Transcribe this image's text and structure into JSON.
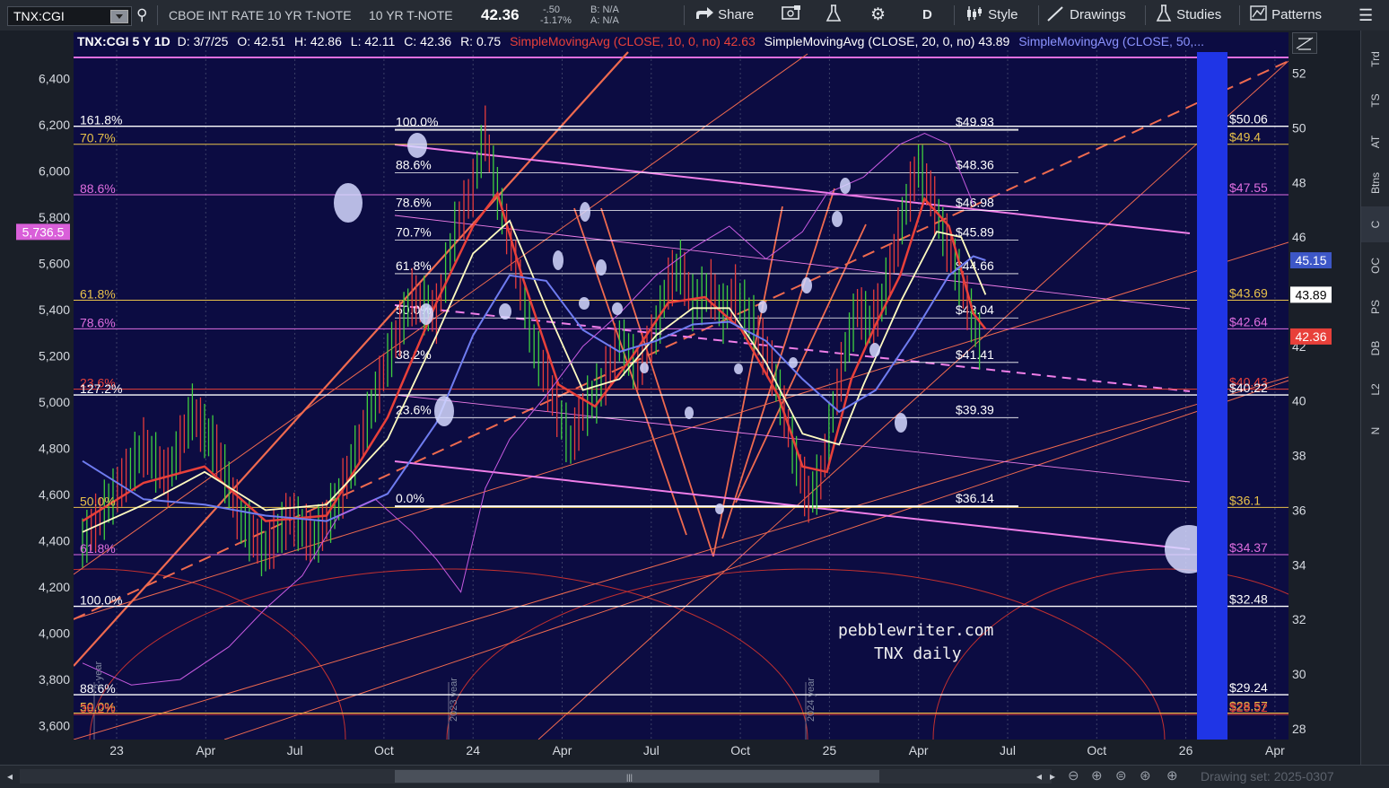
{
  "toolbar": {
    "symbol": "TNX:CGI",
    "exchange": "CBOE INT RATE 10 YR T-NOTE",
    "description": "10 YR T-NOTE",
    "last": "42.36",
    "change": "-.50",
    "change_pct": "-1.17%",
    "bid": "B: N/A",
    "ask": "A: N/A",
    "share": "Share",
    "period": "D",
    "style": "Style",
    "drawings": "Drawings",
    "studies": "Studies",
    "patterns": "Patterns"
  },
  "header": {
    "symbol": "TNX:CGI 5 Y 1D",
    "date": "D: 3/7/25",
    "open": "O: 42.51",
    "high": "H: 42.86",
    "low": "L: 42.11",
    "close": "C: 42.36",
    "range": "R: 0.75",
    "sma10": "SimpleMovingAvg (CLOSE, 10, 0, no)",
    "sma10_val": "42.63",
    "sma20": "SimpleMovingAvg (CLOSE, 20, 0, no)",
    "sma20_val": "43.89",
    "sma50": "SimpleMovingAvg (CLOSE, 50,..."
  },
  "right_tabs": [
    "Trd",
    "TS",
    "AT",
    "Btns",
    "C",
    "OC",
    "PS",
    "DB",
    "L2",
    "N"
  ],
  "watermark": [
    "pebblewriter.com",
    "TNX daily"
  ],
  "cycle_labels": [
    "2-year",
    "2023 year",
    "2024 year"
  ],
  "drawing_set": "Drawing set: 2025-0307",
  "chart_data": {
    "type": "line",
    "x_ticks": [
      "23",
      "Apr",
      "Jul",
      "Oct",
      "24",
      "Apr",
      "Jul",
      "Oct",
      "25",
      "Apr",
      "Jul",
      "Oct",
      "26",
      "Apr"
    ],
    "left_axis": {
      "ticks": [
        "6,400",
        "6,200",
        "6,000",
        "5,800",
        "5,600",
        "5,400",
        "5,200",
        "5,000",
        "4,800",
        "4,600",
        "4,400",
        "4,200",
        "4,000",
        "3,800",
        "3,600"
      ],
      "range": [
        3540,
        6600
      ],
      "marker": "5,736.5"
    },
    "right_axis": {
      "ticks": [
        "52",
        "50",
        "48",
        "46",
        "44",
        "42",
        "40",
        "38",
        "36",
        "34",
        "32",
        "30",
        "28"
      ],
      "range": [
        27.6,
        53.5
      ],
      "badges": [
        {
          "text": "45.15",
          "value": 45.15,
          "bg": "#3d57c7",
          "fg": "#ffffff"
        },
        {
          "text": "43.89",
          "value": 43.89,
          "bg": "#ffffff",
          "fg": "#000000"
        },
        {
          "text": "42.36",
          "value": 42.36,
          "bg": "#e8403a",
          "fg": "#ffffff"
        }
      ]
    },
    "fib_levels": [
      {
        "pct": "100.0%",
        "price": "$49.93",
        "value": 49.93
      },
      {
        "pct": "88.6%",
        "price": "$48.36",
        "value": 48.36
      },
      {
        "pct": "78.6%",
        "price": "$46.98",
        "value": 46.98
      },
      {
        "pct": "70.7%",
        "price": "$45.89",
        "value": 45.89
      },
      {
        "pct": "61.8%",
        "price": "$44.66",
        "value": 44.66
      },
      {
        "pct": "50.0%",
        "price": "$43.04",
        "value": 43.04
      },
      {
        "pct": "38.2%",
        "price": "$41.41",
        "value": 41.41
      },
      {
        "pct": "23.6%",
        "price": "$39.39",
        "value": 39.39
      },
      {
        "pct": "0.0%",
        "price": "$36.14",
        "value": 36.14
      }
    ],
    "horizontal_levels": [
      {
        "left": "161.8%",
        "right": "$50.06",
        "value": 50.06,
        "color": "#ffffff",
        "lcolor": "#ffffff",
        "rcolor": "#ffffff"
      },
      {
        "left": "70.7%",
        "right": "$49.4",
        "value": 49.4,
        "color": "#e8c14a",
        "lcolor": "#e8c14a",
        "rcolor": "#e8c14a"
      },
      {
        "left": "88.6%",
        "right": "$47.55",
        "value": 47.55,
        "color": "#e06ee0",
        "lcolor": "#e06ee0",
        "rcolor": "#e06ee0"
      },
      {
        "left": "61.8%",
        "right": "$43.69",
        "value": 43.69,
        "color": "#e8c14a",
        "lcolor": "#e8c14a",
        "rcolor": "#e8c14a"
      },
      {
        "left": "78.6%",
        "right": "$42.64",
        "value": 42.64,
        "color": "#e06ee0",
        "lcolor": "#e06ee0",
        "rcolor": "#e06ee0"
      },
      {
        "left": "23.6%",
        "right": "$40.43",
        "value": 40.43,
        "color": "#e8403a",
        "lcolor": "#e8403a",
        "rcolor": "#e8403a"
      },
      {
        "left": "127.2%",
        "right": "$40.22",
        "value": 40.22,
        "color": "#ffffff",
        "lcolor": "#ffffff",
        "rcolor": "#ffffff"
      },
      {
        "left": "50.0%",
        "right": "$36.1",
        "value": 36.1,
        "color": "#e8c14a",
        "lcolor": "#e8c14a",
        "rcolor": "#e8c14a"
      },
      {
        "left": "61.8%",
        "right": "$34.37",
        "value": 34.37,
        "color": "#e06ee0",
        "lcolor": "#e06ee0",
        "rcolor": "#e06ee0"
      },
      {
        "left": "100.0%",
        "right": "$32.48",
        "value": 32.48,
        "color": "#ffffff",
        "lcolor": "#ffffff",
        "rcolor": "#ffffff"
      },
      {
        "left": "88.6%",
        "right": "$29.24",
        "value": 29.24,
        "color": "#ffffff",
        "lcolor": "#ffffff",
        "rcolor": "#ffffff"
      },
      {
        "left": "50.0%",
        "right": "$28.57",
        "value": 28.57,
        "color": "#e8c14a",
        "lcolor": "#e8c14a",
        "rcolor": "#e8c14a"
      },
      {
        "left": "38.2%",
        "right": "$28.52",
        "value": 28.52,
        "color": "#e8403a",
        "lcolor": "#e8403a",
        "rcolor": "#e8403a"
      }
    ],
    "series": [
      {
        "name": "SimpleMovingAvg (CLOSE, 10, 0, no)",
        "color": "#e8403a"
      },
      {
        "name": "SimpleMovingAvg (CLOSE, 20, 0, no)",
        "color": "#ffffff"
      },
      {
        "name": "SimpleMovingAvg (CLOSE, 50,...",
        "color": "#6f7cf0"
      }
    ],
    "price_path": [
      [
        0,
        34.8
      ],
      [
        5,
        36.5
      ],
      [
        10,
        38.3
      ],
      [
        14,
        37.2
      ],
      [
        18,
        39.6
      ],
      [
        22,
        38.2
      ],
      [
        26,
        35.6
      ],
      [
        30,
        34.5
      ],
      [
        34,
        35.8
      ],
      [
        38,
        34.9
      ],
      [
        42,
        36.4
      ],
      [
        46,
        38.8
      ],
      [
        50,
        41.5
      ],
      [
        54,
        43.8
      ],
      [
        58,
        43.2
      ],
      [
        61,
        46.2
      ],
      [
        64,
        47.8
      ],
      [
        66,
        49.8
      ],
      [
        68,
        47.6
      ],
      [
        71,
        45.0
      ],
      [
        74,
        42.0
      ],
      [
        77,
        40.2
      ],
      [
        80,
        38.4
      ],
      [
        82,
        39.6
      ],
      [
        85,
        40.5
      ],
      [
        88,
        42.2
      ],
      [
        91,
        41.2
      ],
      [
        94,
        42.6
      ],
      [
        96,
        44.3
      ],
      [
        98,
        44.9
      ],
      [
        100,
        43.6
      ],
      [
        103,
        44.1
      ],
      [
        105,
        43.2
      ],
      [
        107,
        43.9
      ],
      [
        110,
        42.8
      ],
      [
        113,
        41.2
      ],
      [
        115,
        39.6
      ],
      [
        117,
        37.8
      ],
      [
        119,
        36.4
      ],
      [
        121,
        37.2
      ],
      [
        123,
        39.6
      ],
      [
        125,
        41.8
      ],
      [
        127,
        43.4
      ],
      [
        129,
        42.8
      ],
      [
        131,
        43.6
      ],
      [
        133,
        45.4
      ],
      [
        135,
        47.2
      ],
      [
        137,
        48.6
      ],
      [
        139,
        47.6
      ],
      [
        141,
        46.2
      ],
      [
        143,
        45.0
      ],
      [
        145,
        43.6
      ],
      [
        147,
        42.2
      ],
      [
        148,
        42.36
      ]
    ],
    "sma_paths": {
      "sma10": [
        [
          0,
          35.6
        ],
        [
          10,
          37.0
        ],
        [
          20,
          37.6
        ],
        [
          30,
          35.6
        ],
        [
          40,
          35.8
        ],
        [
          50,
          39.4
        ],
        [
          58,
          43.6
        ],
        [
          64,
          46.4
        ],
        [
          68,
          47.6
        ],
        [
          72,
          44.6
        ],
        [
          78,
          40.6
        ],
        [
          84,
          39.8
        ],
        [
          90,
          41.6
        ],
        [
          96,
          43.6
        ],
        [
          102,
          43.8
        ],
        [
          108,
          42.6
        ],
        [
          114,
          40.2
        ],
        [
          118,
          37.6
        ],
        [
          122,
          37.4
        ],
        [
          126,
          40.8
        ],
        [
          130,
          42.8
        ],
        [
          134,
          44.6
        ],
        [
          138,
          47.4
        ],
        [
          142,
          46.4
        ],
        [
          146,
          43.2
        ],
        [
          148,
          42.63
        ]
      ],
      "sma20": [
        [
          0,
          35.2
        ],
        [
          10,
          36.2
        ],
        [
          20,
          37.4
        ],
        [
          30,
          36.0
        ],
        [
          40,
          36.2
        ],
        [
          50,
          38.6
        ],
        [
          58,
          42.4
        ],
        [
          64,
          45.4
        ],
        [
          70,
          46.6
        ],
        [
          76,
          43.4
        ],
        [
          82,
          40.4
        ],
        [
          88,
          40.8
        ],
        [
          94,
          42.4
        ],
        [
          100,
          43.4
        ],
        [
          106,
          43.4
        ],
        [
          112,
          41.4
        ],
        [
          118,
          38.8
        ],
        [
          124,
          38.4
        ],
        [
          128,
          40.6
        ],
        [
          134,
          43.6
        ],
        [
          140,
          46.2
        ],
        [
          144,
          46.0
        ],
        [
          148,
          43.89
        ]
      ],
      "sma50": [
        [
          0,
          37.8
        ],
        [
          10,
          36.4
        ],
        [
          20,
          36.2
        ],
        [
          30,
          35.8
        ],
        [
          40,
          35.6
        ],
        [
          50,
          36.6
        ],
        [
          58,
          39.2
        ],
        [
          64,
          42.4
        ],
        [
          70,
          44.6
        ],
        [
          76,
          44.4
        ],
        [
          82,
          42.6
        ],
        [
          88,
          41.8
        ],
        [
          94,
          42.2
        ],
        [
          100,
          42.8
        ],
        [
          106,
          42.9
        ],
        [
          112,
          42.2
        ],
        [
          118,
          40.8
        ],
        [
          124,
          39.6
        ],
        [
          130,
          40.4
        ],
        [
          136,
          42.4
        ],
        [
          142,
          44.6
        ],
        [
          146,
          45.3
        ],
        [
          148,
          45.15
        ]
      ]
    }
  }
}
